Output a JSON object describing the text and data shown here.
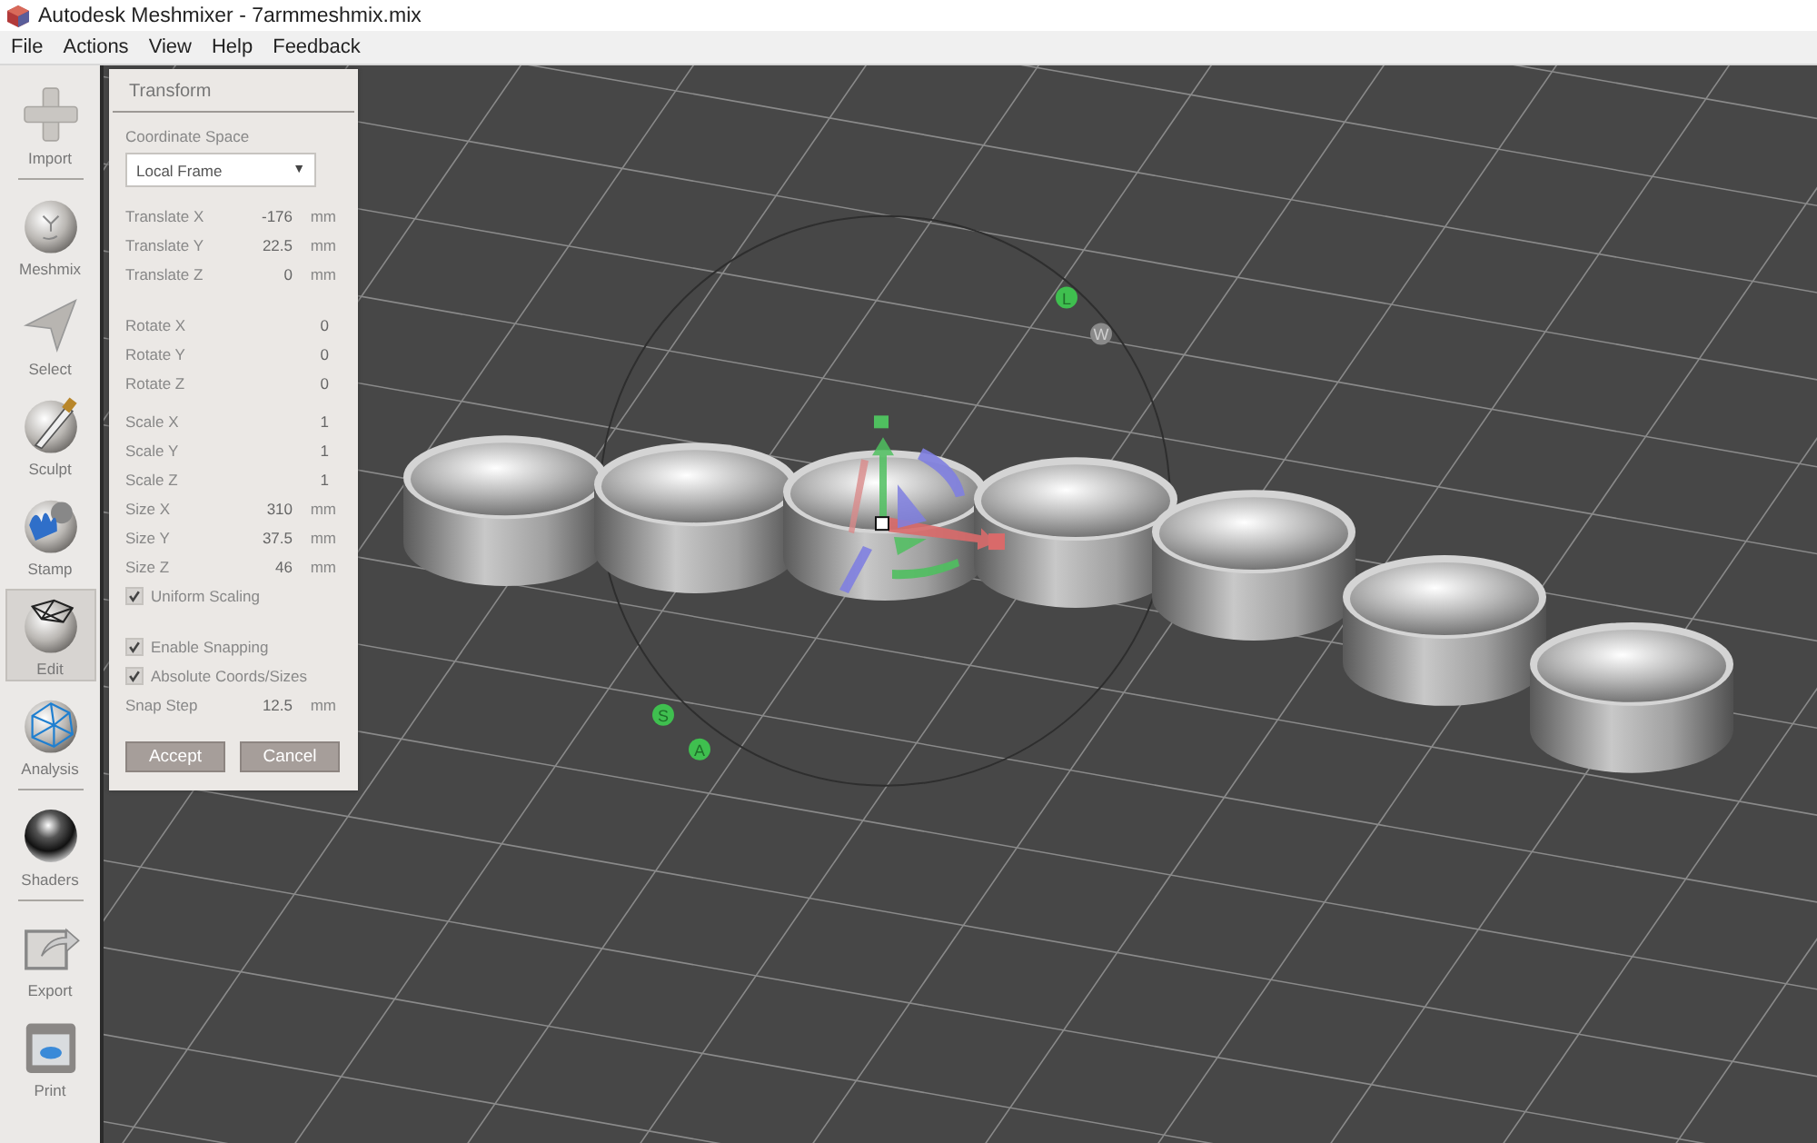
{
  "window": {
    "title": "Autodesk Meshmixer - 7armmeshmix.mix"
  },
  "menu": [
    "File",
    "Actions",
    "View",
    "Help",
    "Feedback"
  ],
  "tools": [
    {
      "label": "Import",
      "selected": false,
      "divider_after": true
    },
    {
      "label": "Meshmix",
      "selected": false,
      "divider_after": false
    },
    {
      "label": "Select",
      "selected": false,
      "divider_after": false
    },
    {
      "label": "Sculpt",
      "selected": false,
      "divider_after": false
    },
    {
      "label": "Stamp",
      "selected": false,
      "divider_after": false
    },
    {
      "label": "Edit",
      "selected": true,
      "divider_after": false
    },
    {
      "label": "Analysis",
      "selected": false,
      "divider_after": true
    },
    {
      "label": "Shaders",
      "selected": false,
      "divider_after": true
    },
    {
      "label": "Export",
      "selected": false,
      "divider_after": false
    },
    {
      "label": "Print",
      "selected": false,
      "divider_after": false
    }
  ],
  "panel": {
    "title": "Transform",
    "coordinate_space": {
      "label": "Coordinate Space",
      "value": "Local Frame",
      "caret": "▼"
    },
    "groups": [
      [
        {
          "kind": "value",
          "label": "Translate X",
          "value": "-176",
          "unit": "mm"
        },
        {
          "kind": "value",
          "label": "Translate Y",
          "value": "22.5",
          "unit": "mm"
        },
        {
          "kind": "value",
          "label": "Translate Z",
          "value": "0",
          "unit": "mm"
        }
      ],
      [
        {
          "kind": "value",
          "label": "Rotate X",
          "value": "0"
        },
        {
          "kind": "value",
          "label": "Rotate Y",
          "value": "0"
        },
        {
          "kind": "value",
          "label": "Rotate Z",
          "value": "0"
        }
      ],
      [
        {
          "kind": "value",
          "label": "Scale X",
          "value": "1"
        },
        {
          "kind": "value",
          "label": "Scale Y",
          "value": "1"
        },
        {
          "kind": "value",
          "label": "Scale Z",
          "value": "1"
        },
        {
          "kind": "value",
          "label": "Size X",
          "value": "310",
          "unit": "mm"
        },
        {
          "kind": "value",
          "label": "Size Y",
          "value": "37.5",
          "unit": "mm"
        },
        {
          "kind": "value",
          "label": "Size Z",
          "value": "46",
          "unit": "mm"
        },
        {
          "kind": "checkbox",
          "label": "Uniform Scaling",
          "checked": true
        }
      ],
      [
        {
          "kind": "checkbox",
          "label": "Enable Snapping",
          "checked": true
        },
        {
          "kind": "checkbox",
          "label": "Absolute Coords/Sizes",
          "checked": true
        },
        {
          "kind": "value",
          "label": "Snap Step",
          "value": "12.5",
          "unit": "mm"
        }
      ]
    ],
    "buttons": [
      "Accept",
      "Cancel"
    ]
  },
  "gizmo_handles": [
    {
      "label": "L",
      "selected": true
    },
    {
      "label": "W",
      "selected": false
    },
    {
      "label": "S",
      "selected": true
    },
    {
      "label": "A",
      "selected": true
    }
  ]
}
